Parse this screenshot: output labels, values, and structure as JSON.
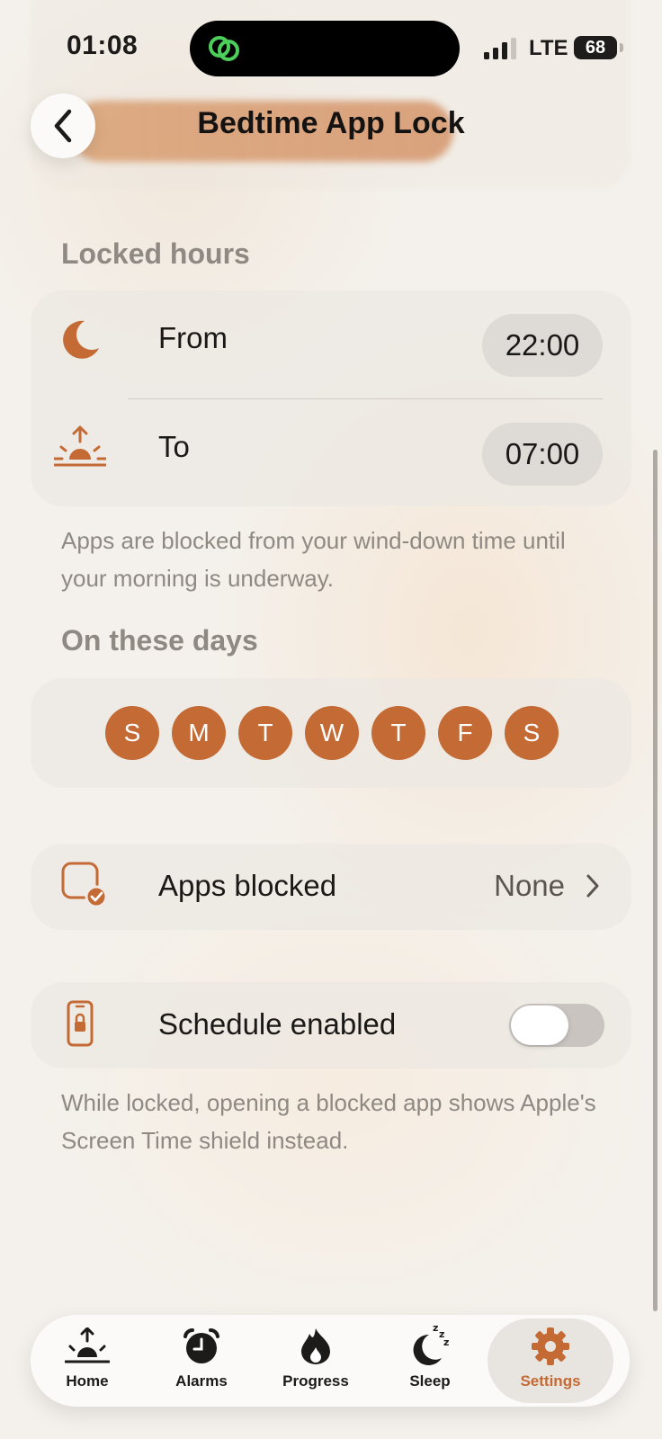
{
  "status": {
    "time": "01:08",
    "network": "LTE",
    "battery": "68"
  },
  "header": {
    "title": "Bedtime App Lock"
  },
  "locked_hours": {
    "heading": "Locked hours",
    "from_label": "From",
    "from_value": "22:00",
    "to_label": "To",
    "to_value": "07:00",
    "helper": "Apps are blocked from your wind-down time until your morning is underway."
  },
  "days": {
    "heading": "On these days",
    "items": [
      "S",
      "M",
      "T",
      "W",
      "T",
      "F",
      "S"
    ]
  },
  "apps": {
    "label": "Apps blocked",
    "value": "None"
  },
  "schedule": {
    "label": "Schedule enabled",
    "enabled": false,
    "helper": "While locked, opening a blocked app shows Apple's Screen Time shield instead."
  },
  "tabs": [
    {
      "label": "Home",
      "icon": "sunrise-icon"
    },
    {
      "label": "Alarms",
      "icon": "alarm-clock-icon"
    },
    {
      "label": "Progress",
      "icon": "flame-icon"
    },
    {
      "label": "Sleep",
      "icon": "moon-zzz-icon"
    },
    {
      "label": "Settings",
      "icon": "gear-icon",
      "active": true
    }
  ],
  "colors": {
    "accent": "#c46a35",
    "background": "#f4f1ec"
  }
}
